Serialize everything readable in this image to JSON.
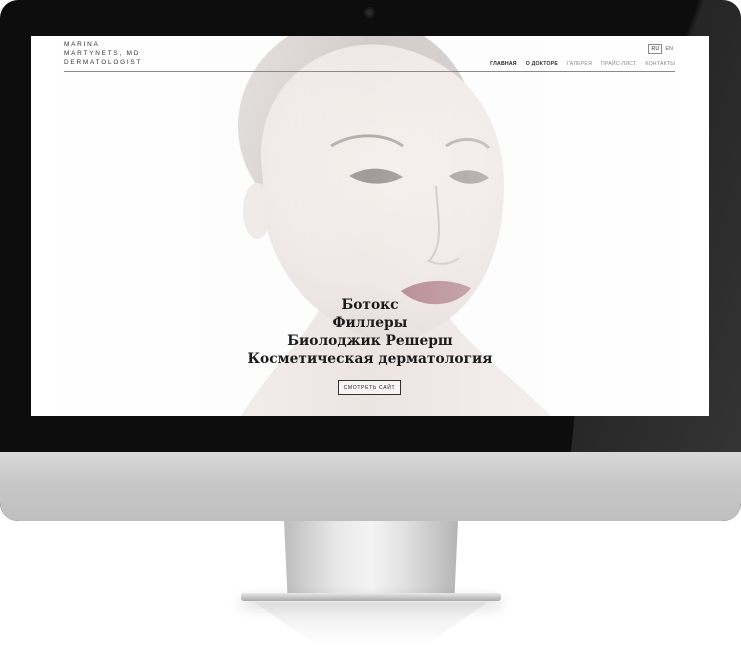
{
  "site": {
    "logo_lines": [
      "MARINA",
      "MARTYNETS, MD",
      "DERMATOLOGIST"
    ],
    "languages": {
      "active": "RU",
      "other": "EN"
    },
    "nav": [
      "ГЛАВНАЯ",
      "О ДОКТОРЕ",
      "ГАЛЕРЕЯ",
      "ПРАЙС-ЛИСТ",
      "КОНТАКТЫ"
    ],
    "headlines": [
      "Ботокс",
      "Филлеры",
      "Биолоджик Решерш",
      "Косметическая дерматология"
    ],
    "cta_label": "СМОТРЕТЬ САЙТ"
  },
  "icons": {
    "camera": "webcam-icon"
  },
  "colors": {
    "bezel": "#0d0d0d",
    "chin": "#c8c8c8",
    "text_dark": "#1b1b1b",
    "nav_muted": "#8a8a8a"
  }
}
